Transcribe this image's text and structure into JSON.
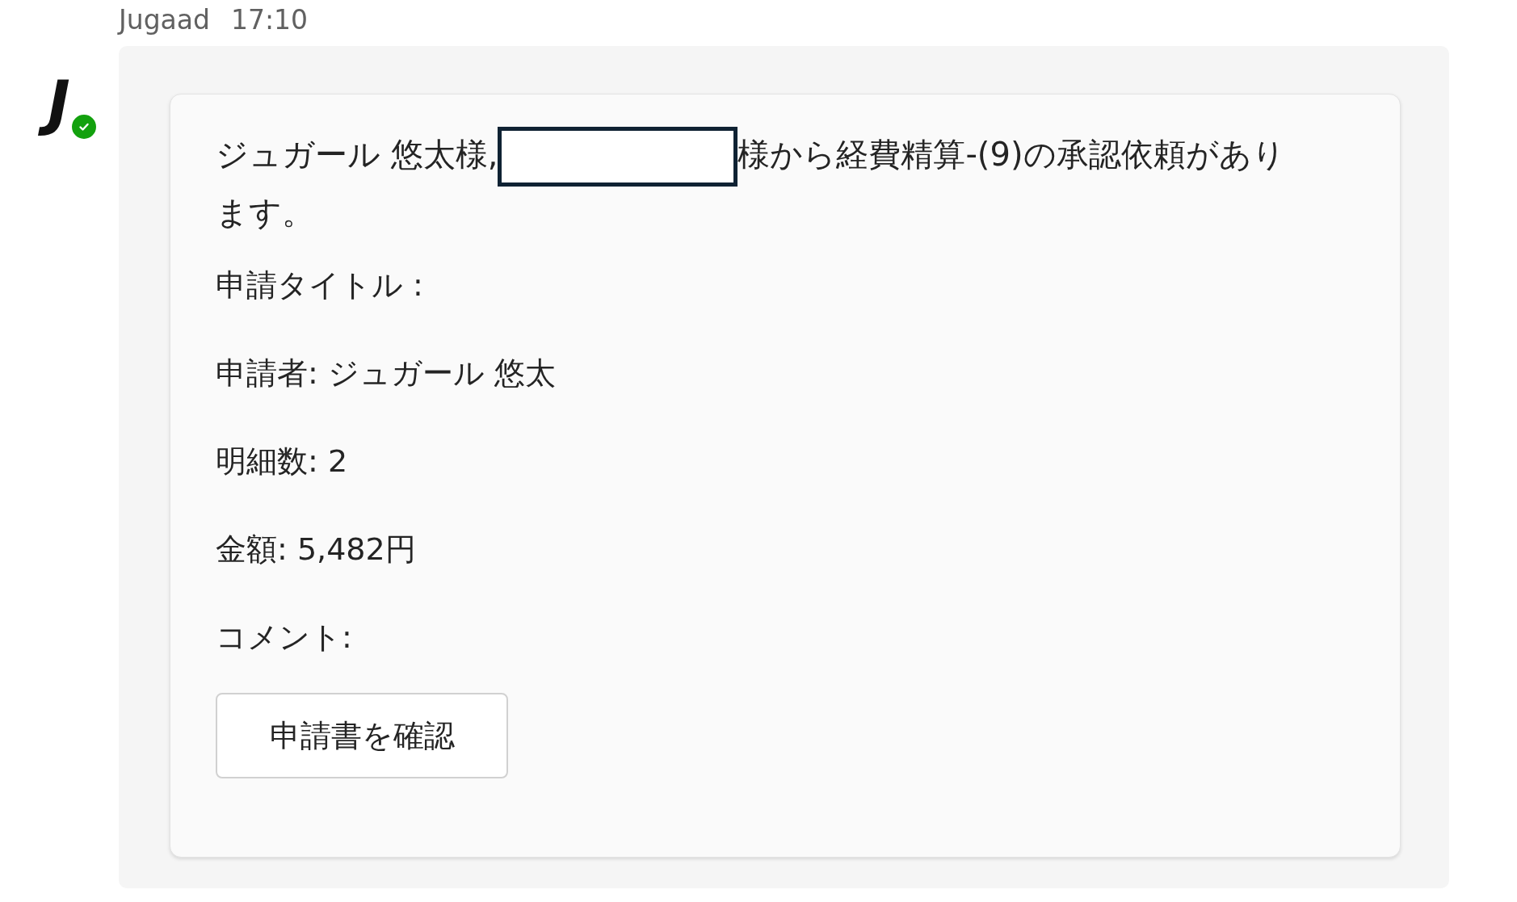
{
  "message": {
    "sender": "Jugaad",
    "time": "17:10",
    "avatar": {
      "initial": "J",
      "online": true
    },
    "card": {
      "intro": {
        "before": "ジュガール 悠太様,",
        "redacted": true,
        "after": "様から経費精算-(9)の承認依頼があり",
        "continued": "ます。"
      },
      "lines": [
        "申請タイトル :",
        "申請者: ジュガール 悠太",
        "明細数: 2",
        "金額: 5,482円",
        "コメント:"
      ],
      "button": "申請書を確認"
    }
  }
}
